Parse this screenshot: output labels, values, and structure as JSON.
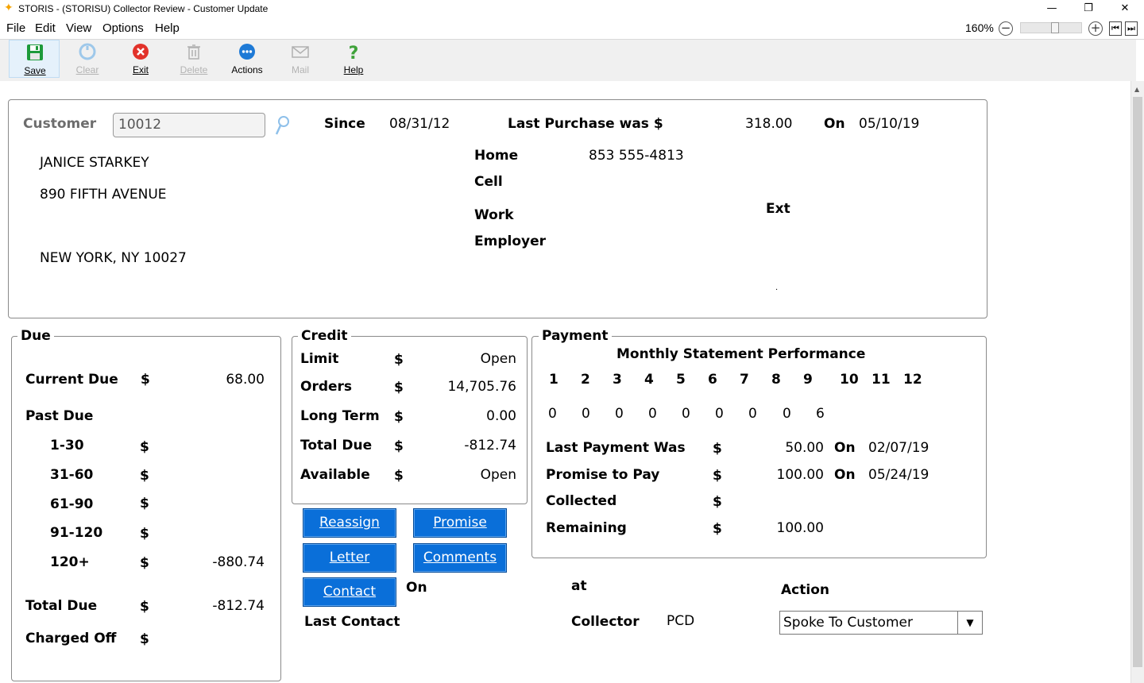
{
  "window": {
    "title": "STORIS - (STORISU) Collector Review - Customer Update",
    "minimize": "—",
    "restore": "❐",
    "close": "✕"
  },
  "menu": {
    "items": [
      "File",
      "Edit",
      "View",
      "Options",
      "Help"
    ],
    "zoom_label": "160%"
  },
  "toolbar": {
    "save": "Save",
    "clear": "Clear",
    "exit": "Exit",
    "delete": "Delete",
    "actions": "Actions",
    "mail": "Mail",
    "help": "Help"
  },
  "customer": {
    "label": "Customer",
    "number": "10012",
    "since_label": "Since",
    "since": "08/31/12",
    "last_purchase_label": "Last Purchase was $",
    "last_purchase_amount": "318.00",
    "on_label": "On",
    "last_purchase_date": "05/10/19",
    "name": "JANICE STARKEY",
    "address1": "890 FIFTH AVENUE",
    "city_state_zip": "NEW YORK, NY 10027",
    "home_label": "Home",
    "home_phone": "853 555-4813",
    "cell_label": "Cell",
    "work_label": "Work",
    "ext_label": "Ext",
    "employer_label": "Employer",
    "dot": "."
  },
  "due": {
    "legend": "Due",
    "current_due_label": "Current Due",
    "current_due": "68.00",
    "past_due_label": "Past Due",
    "buckets": [
      {
        "label": "1-30",
        "value": ""
      },
      {
        "label": "31-60",
        "value": ""
      },
      {
        "label": "61-90",
        "value": ""
      },
      {
        "label": "91-120",
        "value": ""
      },
      {
        "label": "120+",
        "value": "-880.74"
      }
    ],
    "total_due_label": "Total Due",
    "total_due": "-812.74",
    "charged_off_label": "Charged Off",
    "currency": "$"
  },
  "credit": {
    "legend": "Credit",
    "rows": [
      {
        "label": "Limit",
        "value": "Open"
      },
      {
        "label": "Orders",
        "value": "14,705.76"
      },
      {
        "label": "Long Term",
        "value": "0.00"
      },
      {
        "label": "Total Due",
        "value": "-812.74"
      },
      {
        "label": "Available",
        "value": "Open"
      }
    ],
    "currency": "$"
  },
  "buttons": {
    "reassign": "Reassign",
    "promise": "Promise",
    "letter": "Letter",
    "comments": "Comments",
    "contact": "Contact"
  },
  "contact": {
    "on_label": "On",
    "last_contact_label": "Last Contact",
    "at_label": "at",
    "collector_label": "Collector",
    "collector": "PCD",
    "action_label": "Action",
    "action_value": "Spoke To Customer"
  },
  "payment": {
    "legend": "Payment",
    "performance_title": "Monthly Statement Performance",
    "months": [
      "1",
      "2",
      "3",
      "4",
      "5",
      "6",
      "7",
      "8",
      "9",
      "10",
      "11",
      "12"
    ],
    "performance": [
      "0",
      "0",
      "0",
      "0",
      "0",
      "0",
      "0",
      "0",
      "6",
      "",
      "",
      ""
    ],
    "last_payment_label": "Last Payment Was",
    "last_payment": "50.00",
    "last_payment_date": "02/07/19",
    "promise_label": "Promise to Pay",
    "promise_amount": "100.00",
    "promise_date": "05/24/19",
    "collected_label": "Collected",
    "collected": "",
    "remaining_label": "Remaining",
    "remaining": "100.00",
    "on_label": "On",
    "currency": "$"
  }
}
